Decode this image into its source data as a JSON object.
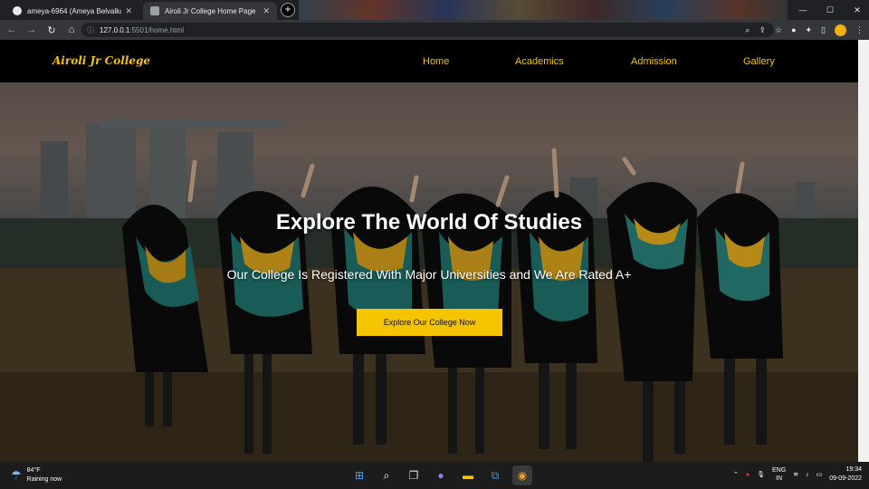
{
  "browser": {
    "tabs": [
      {
        "title": "ameya-6964 (Ameya Belvalkar)",
        "active": false
      },
      {
        "title": "Airoli Jr College Home Page",
        "active": true
      }
    ],
    "new_tab_label": "+",
    "url_host": "127.0.0.1",
    "url_path": ":5501/home.html"
  },
  "site": {
    "brand": "Airoli Jr College",
    "nav": [
      "Home",
      "Academics",
      "Admission",
      "Gallery"
    ],
    "hero": {
      "title": "Explore The World Of Studies",
      "subtitle": "Our College Is Registered With Major Universities and We Are Rated A+",
      "cta": "Explore Our College Now"
    },
    "colors": {
      "accent": "#f5c400",
      "nav_bg": "#000000"
    }
  },
  "taskbar": {
    "weather_temp": "84°F",
    "weather_desc": "Raining now",
    "lang_line1": "ENG",
    "lang_line2": "IN",
    "time": "19:34",
    "date": "09-09-2022"
  }
}
